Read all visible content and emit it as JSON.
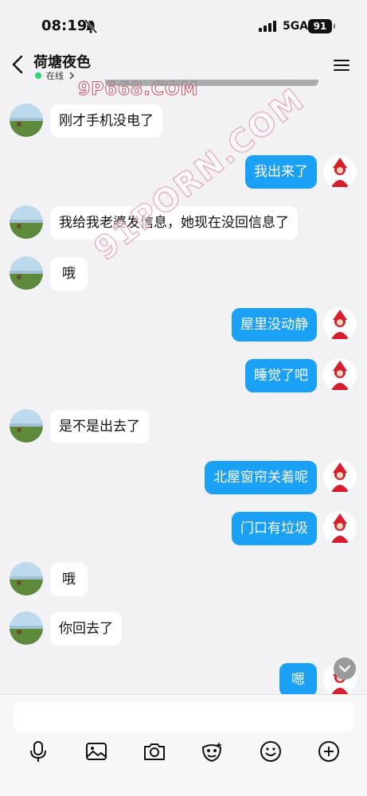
{
  "status_bar": {
    "time": "08:19",
    "network": "5GA",
    "battery": "91"
  },
  "header": {
    "title": "荷塘夜色",
    "presence": "在线"
  },
  "watermarks": {
    "top": "9P668.COM",
    "diagonal": "91PORN.COM"
  },
  "messages": [
    {
      "side": "left",
      "text": "刚才手机没电了"
    },
    {
      "side": "right",
      "text": "我出来了"
    },
    {
      "side": "left",
      "text": "我给我老婆发信息，她现在没回信息了"
    },
    {
      "side": "left",
      "text": "哦"
    },
    {
      "side": "right",
      "text": "屋里没动静"
    },
    {
      "side": "right",
      "text": "睡觉了吧"
    },
    {
      "side": "left",
      "text": "是不是出去了"
    },
    {
      "side": "right",
      "text": "北屋窗帘关着呢"
    },
    {
      "side": "right",
      "text": "门口有垃圾"
    },
    {
      "side": "left",
      "text": "哦"
    },
    {
      "side": "left",
      "text": "你回去了"
    },
    {
      "side": "right",
      "text": "嗯"
    }
  ],
  "toolbar_icons": [
    "microphone-icon",
    "image-icon",
    "camera-icon",
    "sticker-icon",
    "emoji-icon",
    "plus-icon"
  ],
  "colors": {
    "accent": "#1aa0f5",
    "online": "#2fd46f"
  }
}
